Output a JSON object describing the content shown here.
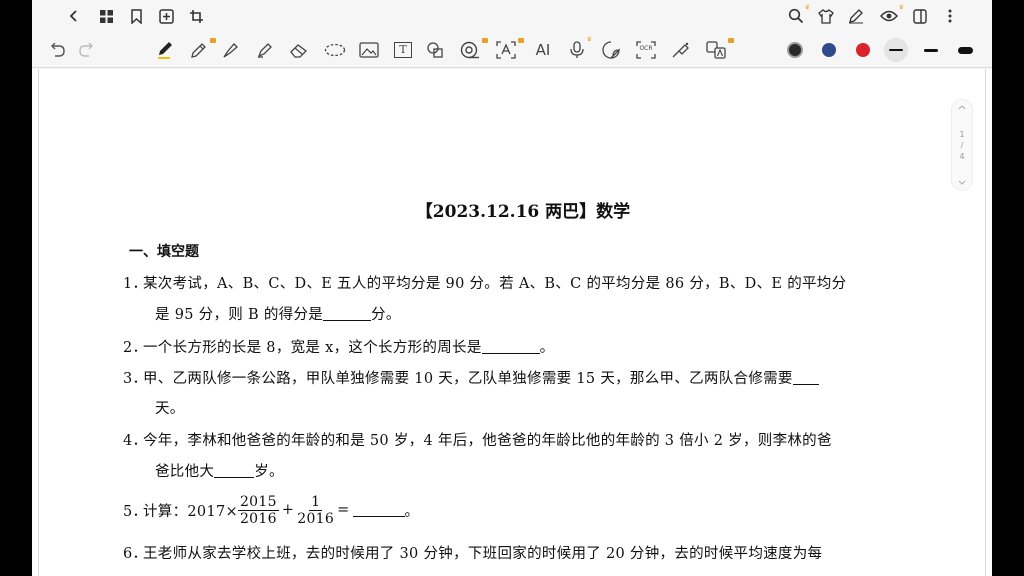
{
  "topbar": {
    "icons": [
      "back-icon",
      "grid-icon",
      "bookmark-icon",
      "add-page-icon",
      "crop-icon",
      "search-icon",
      "shirt-icon",
      "pen-settings-icon",
      "eye-icon",
      "sidebar-icon",
      "more-icon"
    ]
  },
  "toolbar": {
    "ai_label": "AI",
    "ocr_label": "OCR",
    "text_label": "T",
    "colors": [
      "#2a2a2a",
      "#2f4a8c",
      "#d9232d",
      "#1a1a1a"
    ]
  },
  "pager": {
    "current": "1",
    "sep": "/",
    "total": "4"
  },
  "doc": {
    "title": "【2023.12.16 两巴】数学",
    "section": "一、填空题",
    "q1_num": "1．",
    "q1_line1": "某次考试，A、B、C、D、E 五人的平均分是 90 分。若 A、B、C 的平均分是 86 分，B、D、E 的平均分",
    "q1_line2a": "是 95 分，则 B 的得分是",
    "q1_line2b": "分。",
    "q2_num": "2．",
    "q2_a": "一个长方形的长是 8，宽是 x，这个长方形的周长是",
    "q2_b": "。",
    "q3_num": "3．",
    "q3_line1": "甲、乙两队修一条公路，甲队单独修需要 10 天，乙队单独修需要 15 天，那么甲、乙两队合修需要",
    "q3_line2": "天。",
    "q4_num": "4．",
    "q4_line1": "今年，李林和他爸爸的年龄的和是 50 岁，4 年后，他爸爸的年龄比他的年龄的 3 倍小 2 岁，则李林的爸",
    "q4_line2a": "爸比他大",
    "q4_line2b": "岁。",
    "q5_num": "5．",
    "q5_a": "计算：2017×",
    "q5_f1_n": "2015",
    "q5_f1_d": "2016",
    "q5_plus": "+",
    "q5_f2_n": "1",
    "q5_f2_d": "2016",
    "q5_eq": "=",
    "q5_end": "。",
    "q6_num": "6．",
    "q6_line1": "王老师从家去学校上班，去的时候用了 30 分钟，下班回家的时候用了 20 分钟，去的时候平均速度为每"
  }
}
